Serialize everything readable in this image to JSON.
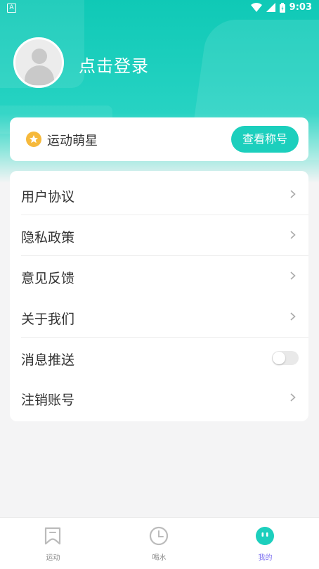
{
  "status_bar": {
    "app_indicator": "A",
    "time": "9:03"
  },
  "profile": {
    "login_text": "点击登录"
  },
  "badge": {
    "title": "运动萌星",
    "button_label": "查看称号"
  },
  "menu": {
    "items": [
      {
        "label": "用户协议",
        "type": "link"
      },
      {
        "label": "隐私政策",
        "type": "link"
      },
      {
        "label": "意见反馈",
        "type": "link"
      },
      {
        "label": "关于我们",
        "type": "link"
      },
      {
        "label": "消息推送",
        "type": "toggle",
        "enabled": false
      },
      {
        "label": "注销账号",
        "type": "link"
      }
    ]
  },
  "tabbar": {
    "tabs": [
      {
        "label": "运动",
        "icon": "exercise-icon",
        "active": false
      },
      {
        "label": "喝水",
        "icon": "clock-icon",
        "active": false
      },
      {
        "label": "我的",
        "icon": "mine-face-icon",
        "active": true
      }
    ]
  },
  "colors": {
    "primary": "#1ccfbd",
    "badge_gold": "#f6b93b",
    "active_tab_text": "#7b6ef0"
  }
}
